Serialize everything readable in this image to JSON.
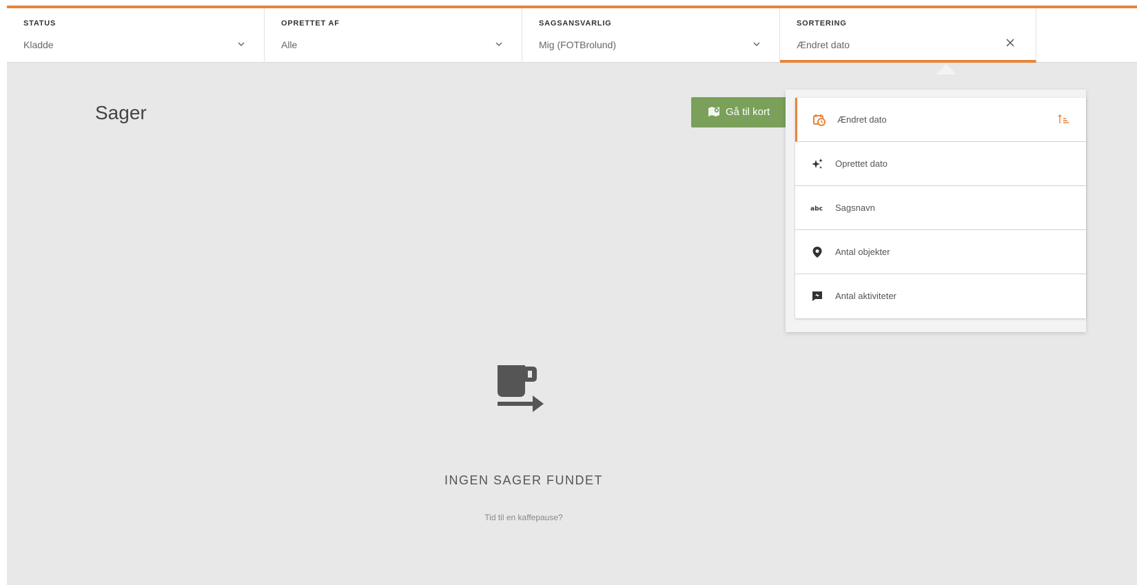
{
  "filters": [
    {
      "label": "STATUS",
      "value": "Kladde"
    },
    {
      "label": "OPRETTET AF",
      "value": "Alle"
    },
    {
      "label": "SAGSANSVARLIG",
      "value": "Mig (FOTBrolund)"
    },
    {
      "label": "SORTERING",
      "value": "Ændret dato"
    }
  ],
  "page": {
    "title": "Sager",
    "map_button_label": "Gå til kort"
  },
  "empty_state": {
    "title": "INGEN SAGER FUNDET",
    "subtitle": "Tid til en kaffepause?"
  },
  "sort_menu": {
    "items": [
      {
        "label": "Ændret dato",
        "icon": "calendar-clock-icon",
        "selected": true
      },
      {
        "label": "Oprettet dato",
        "icon": "sparkle-icon",
        "selected": false
      },
      {
        "label": "Sagsnavn",
        "icon": "abc-icon",
        "selected": false
      },
      {
        "label": "Antal objekter",
        "icon": "map-pin-icon",
        "selected": false
      },
      {
        "label": "Antal aktiviteter",
        "icon": "activity-icon",
        "selected": false
      }
    ]
  },
  "colors": {
    "accent": "#e8843a",
    "button_green": "#7aa05a",
    "background": "#e8e8e8"
  }
}
